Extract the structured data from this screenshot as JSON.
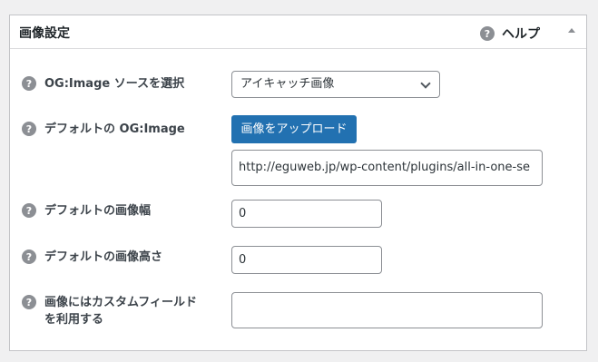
{
  "panel": {
    "title": "画像設定",
    "help_label": "ヘルプ",
    "help_icon": "?"
  },
  "rows": {
    "source": {
      "label": "OG:Image ソースを選択",
      "selected": "アイキャッチ画像"
    },
    "default_image": {
      "label": "デフォルトの OG:Image",
      "button_label": "画像をアップロード",
      "url_value": "http://eguweb.jp/wp-content/plugins/all-in-one-se"
    },
    "width": {
      "label": "デフォルトの画像幅",
      "value": "0"
    },
    "height": {
      "label": "デフォルトの画像高さ",
      "value": "0"
    },
    "custom_field": {
      "label_line1": "画像にはカスタムフィールド",
      "label_line2": "を利用する",
      "value": ""
    }
  },
  "colors": {
    "accent": "#2271b1",
    "help_icon": "#8c8f94"
  }
}
